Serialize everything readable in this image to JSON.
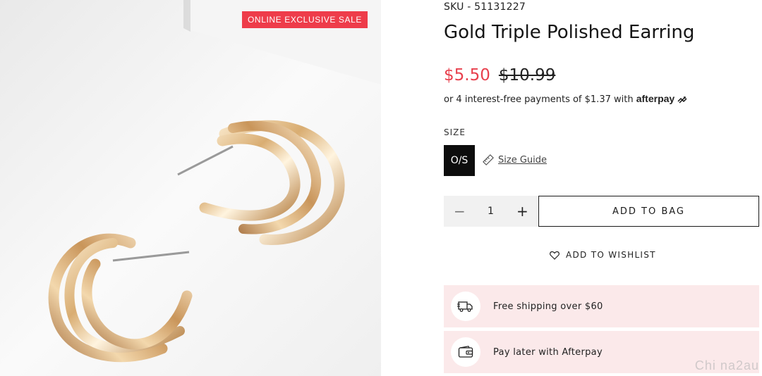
{
  "badge": {
    "label": "ONLINE EXCLUSIVE SALE",
    "color": "#ee3c4a"
  },
  "product": {
    "sku": "SKU - 51131227",
    "title": "Gold Triple Polished Earring",
    "price_sale": "$5.50",
    "price_original": "$10.99",
    "sale_color": "#e8404d"
  },
  "afterpay": {
    "text": "or 4 interest-free payments of $1.37 with",
    "brand": "afterpay"
  },
  "size": {
    "label": "SIZE",
    "selected": "O/S",
    "guide_label": "Size Guide"
  },
  "quantity": {
    "minus": "−",
    "value": "1",
    "plus": "+"
  },
  "actions": {
    "add_to_bag": "ADD TO BAG",
    "wishlist": "ADD TO WISHLIST"
  },
  "perks": [
    {
      "icon": "delivery-truck-icon",
      "label": "Free shipping over $60"
    },
    {
      "icon": "wallet-icon",
      "label": "Pay later with Afterpay"
    }
  ],
  "watermark": "Chi na2au"
}
